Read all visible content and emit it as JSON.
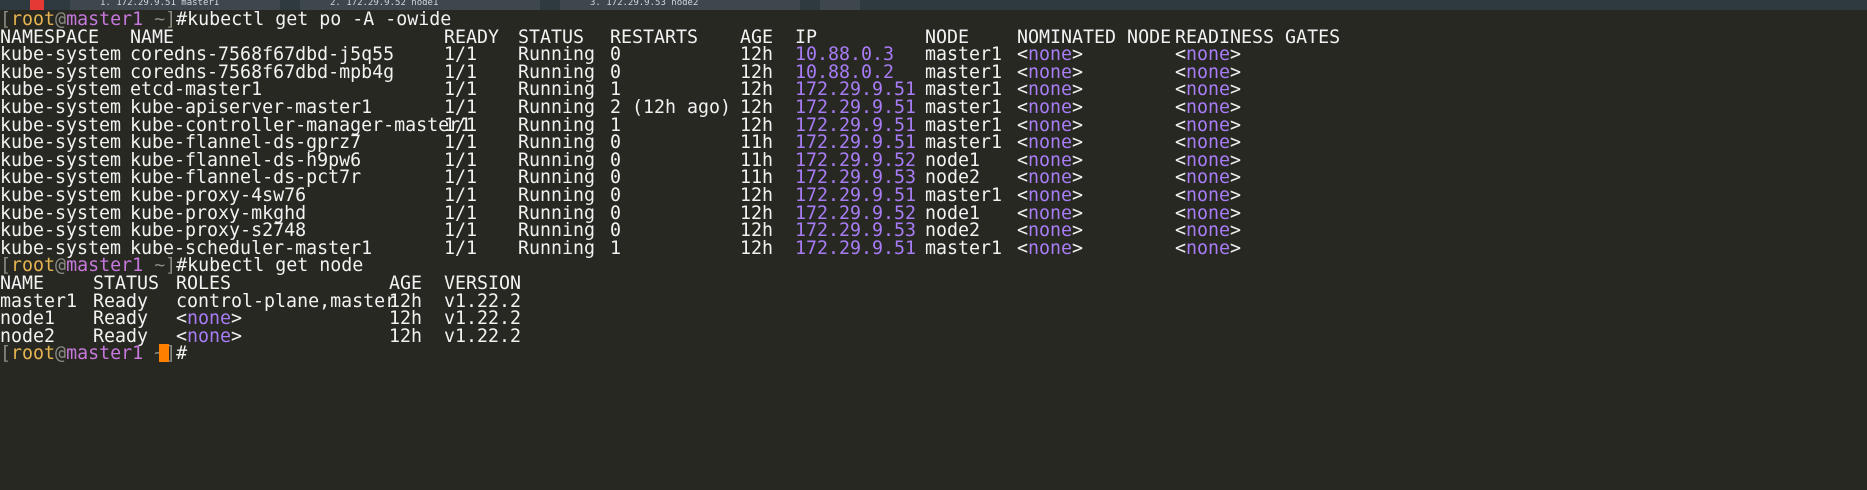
{
  "tabbar": {
    "tabs": [
      {
        "label": "1. 172.29.9.51 master1"
      },
      {
        "label": "2. 172.29.9.52 node1"
      },
      {
        "label": "3. 172.29.9.53 node2"
      }
    ],
    "colors": {
      "bar": "#2f3a40",
      "active_strip": "#e53935"
    }
  },
  "prompt": {
    "open": "[",
    "user": "root",
    "at": "@",
    "host": "master1",
    "path": " ~]",
    "symbol": "#"
  },
  "commands": {
    "get_pods": "kubectl get po -A -owide",
    "get_nodes": "kubectl get node"
  },
  "pods": {
    "headers": [
      "NAMESPACE",
      "NAME",
      "READY",
      "STATUS",
      "RESTARTS",
      "AGE",
      "IP",
      "NODE",
      "NOMINATED NODE",
      "READINESS GATES"
    ],
    "rows": [
      [
        "kube-system",
        "coredns-7568f67dbd-j5q55",
        "1/1",
        "Running",
        "0",
        "12h",
        "10.88.0.3",
        "master1",
        "none",
        "none"
      ],
      [
        "kube-system",
        "coredns-7568f67dbd-mpb4g",
        "1/1",
        "Running",
        "0",
        "12h",
        "10.88.0.2",
        "master1",
        "none",
        "none"
      ],
      [
        "kube-system",
        "etcd-master1",
        "1/1",
        "Running",
        "1",
        "12h",
        "172.29.9.51",
        "master1",
        "none",
        "none"
      ],
      [
        "kube-system",
        "kube-apiserver-master1",
        "1/1",
        "Running",
        "2 (12h ago)",
        "12h",
        "172.29.9.51",
        "master1",
        "none",
        "none"
      ],
      [
        "kube-system",
        "kube-controller-manager-master1",
        "1/1",
        "Running",
        "1",
        "12h",
        "172.29.9.51",
        "master1",
        "none",
        "none"
      ],
      [
        "kube-system",
        "kube-flannel-ds-gprz7",
        "1/1",
        "Running",
        "0",
        "11h",
        "172.29.9.51",
        "master1",
        "none",
        "none"
      ],
      [
        "kube-system",
        "kube-flannel-ds-h9pw6",
        "1/1",
        "Running",
        "0",
        "11h",
        "172.29.9.52",
        "node1",
        "none",
        "none"
      ],
      [
        "kube-system",
        "kube-flannel-ds-pct7r",
        "1/1",
        "Running",
        "0",
        "11h",
        "172.29.9.53",
        "node2",
        "none",
        "none"
      ],
      [
        "kube-system",
        "kube-proxy-4sw76",
        "1/1",
        "Running",
        "0",
        "12h",
        "172.29.9.51",
        "master1",
        "none",
        "none"
      ],
      [
        "kube-system",
        "kube-proxy-mkghd",
        "1/1",
        "Running",
        "0",
        "12h",
        "172.29.9.52",
        "node1",
        "none",
        "none"
      ],
      [
        "kube-system",
        "kube-proxy-s2748",
        "1/1",
        "Running",
        "0",
        "12h",
        "172.29.9.53",
        "node2",
        "none",
        "none"
      ],
      [
        "kube-system",
        "kube-scheduler-master1",
        "1/1",
        "Running",
        "1",
        "12h",
        "172.29.9.51",
        "master1",
        "none",
        "none"
      ]
    ]
  },
  "nodes": {
    "headers": [
      "NAME",
      "STATUS",
      "ROLES",
      "AGE",
      "VERSION"
    ],
    "rows": [
      [
        "master1",
        "Ready",
        "control-plane,master",
        "12h",
        "v1.22.2"
      ],
      [
        "node1",
        "Ready",
        "none",
        "12h",
        "v1.22.2"
      ],
      [
        "node2",
        "Ready",
        "none",
        "12h",
        "v1.22.2"
      ]
    ]
  },
  "theme": {
    "background": "#272822",
    "foreground": "#f2f2f2",
    "ip_color": "#a77cf5",
    "prompt_user_color": "#e6b450",
    "prompt_host_color": "#c678dd",
    "cursor_color": "#ff7f00"
  }
}
